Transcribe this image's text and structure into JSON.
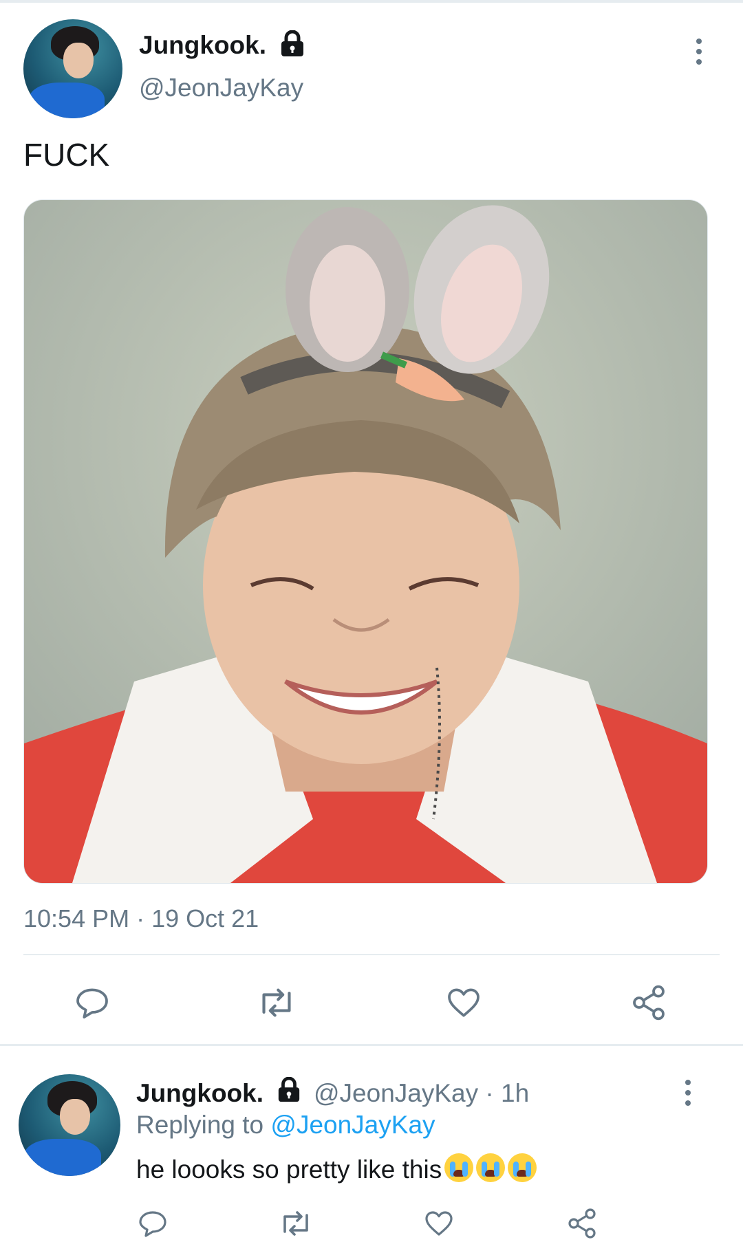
{
  "main_tweet": {
    "author_name": "Jungkook.",
    "handle": "@JeonJayKay",
    "text": "FUCK",
    "timestamp": "10:54 PM · 19 Oct 21",
    "icons": {
      "lock": "lock-icon",
      "more": "more-vertical-icon",
      "reply": "reply-icon",
      "retweet": "retweet-icon",
      "like": "heart-icon",
      "share": "share-icon"
    }
  },
  "reply_tweet": {
    "author_name": "Jungkook.",
    "handle_time": "@JeonJayKay · 1h",
    "replying_prefix": "Replying to",
    "replying_handle": "@JeonJayKay",
    "text": "he loooks so pretty like this",
    "emojis": [
      "loudly-crying-face",
      "loudly-crying-face",
      "loudly-crying-face"
    ]
  },
  "colors": {
    "text": "#14171a",
    "secondary": "#657786",
    "link": "#1da1f2",
    "divider": "#e6ecf0"
  }
}
